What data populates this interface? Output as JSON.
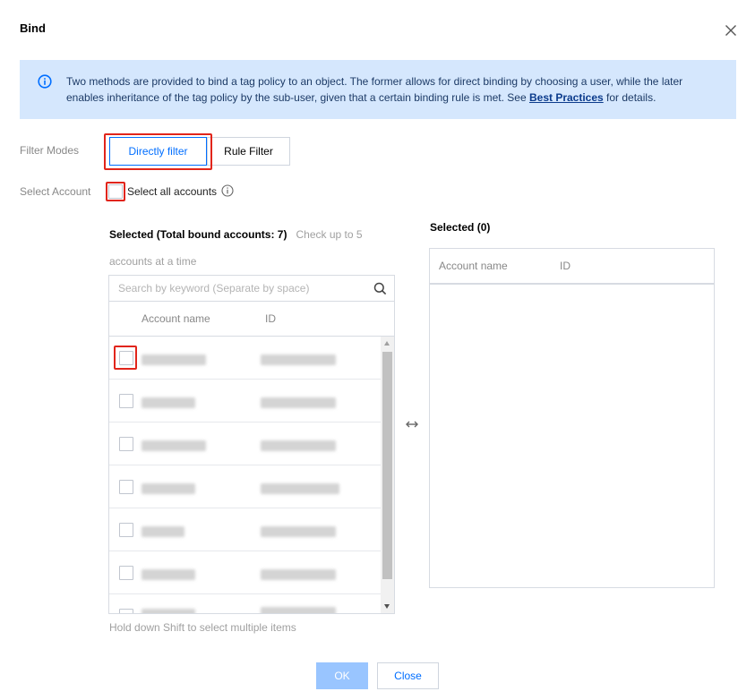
{
  "dialog": {
    "title": "Bind"
  },
  "notice": {
    "text": "Two methods are provided to bind a tag policy to an object. The former allows for direct binding by choosing a user, while the later enables inheritance of the tag policy by the sub-user, given that a certain binding rule is met. See ",
    "link": "Best Practices",
    "suffix": " for details."
  },
  "filter_modes": {
    "label": "Filter Modes",
    "options": [
      "Directly filter",
      "Rule Filter"
    ],
    "selected": "Directly filter"
  },
  "select_account": {
    "label": "Select Account",
    "select_all_label": "Select all accounts",
    "select_all_checked": false
  },
  "left_panel": {
    "title": "Selected (Total bound accounts: 7)",
    "hint": "Check up to 5 accounts at a time",
    "search_placeholder": "Search by keyword (Separate by space)",
    "columns": [
      "Account name",
      "ID"
    ],
    "footer_hint": "Hold down Shift to select multiple items"
  },
  "right_panel": {
    "title": "Selected (0)",
    "columns": [
      "Account name",
      "ID"
    ]
  },
  "footer": {
    "ok_label": "OK",
    "close_label": "Close"
  },
  "colors": {
    "accent": "#006eff",
    "highlight": "#e1251b",
    "notice_bg": "#d5e7fd",
    "ok_disabled_bg": "#99c5ff"
  }
}
